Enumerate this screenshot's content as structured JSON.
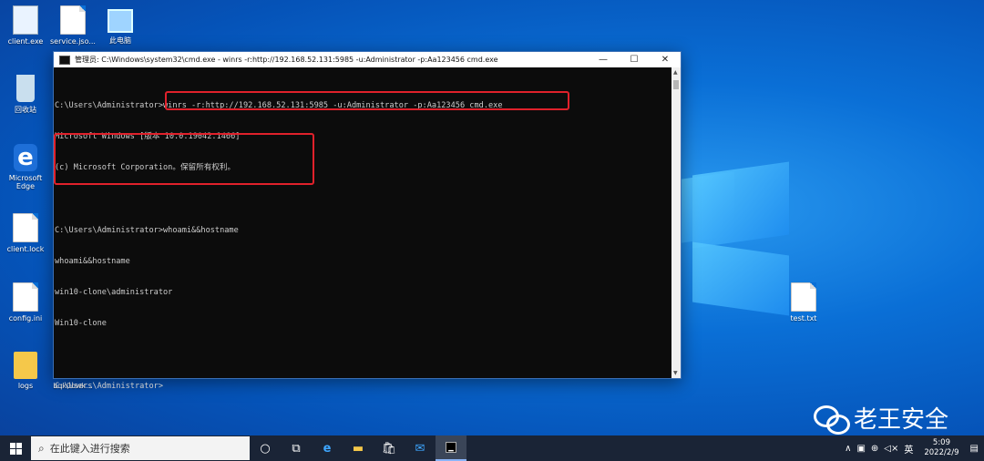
{
  "desktop": {
    "icons": [
      {
        "label": "client.exe",
        "type": "exe"
      },
      {
        "label": "service.jso...",
        "type": "file"
      },
      {
        "label": "此电脑",
        "type": "pc"
      },
      {
        "label": "回收站",
        "type": "recycle"
      },
      {
        "label": "Microsoft Edge",
        "type": "edge"
      },
      {
        "label": "client.lock",
        "type": "file"
      },
      {
        "label": "config.ini",
        "type": "ini"
      },
      {
        "label": "logs",
        "type": "folder"
      },
      {
        "label": "bqk0owk...",
        "type": "folder"
      },
      {
        "label": "test.txt",
        "type": "file"
      }
    ]
  },
  "cmd": {
    "title": "管理员: C:\\Windows\\system32\\cmd.exe - winrs  -r:http://192.168.52.131:5985 -u:Administrator -p:Aa123456 cmd.exe",
    "lines": [
      "C:\\Users\\Administrator>winrs -r:http://192.168.52.131:5985 -u:Administrator -p:Aa123456 cmd.exe",
      "Microsoft Windows [版本 10.0.19042.1466]",
      "(c) Microsoft Corporation。保留所有权利。",
      "",
      "C:\\Users\\Administrator>whoami&&hostname",
      "whoami&&hostname",
      "win10-clone\\administrator",
      "Win10-clone",
      "",
      "C:\\Users\\Administrator>"
    ],
    "minimize": "—",
    "maximize": "☐",
    "close": "✕"
  },
  "watermark": "老王安全",
  "taskbar": {
    "search_placeholder": "在此键入进行搜索",
    "tray_lang": "英",
    "time": "5:09",
    "date": "2022/2/9"
  }
}
